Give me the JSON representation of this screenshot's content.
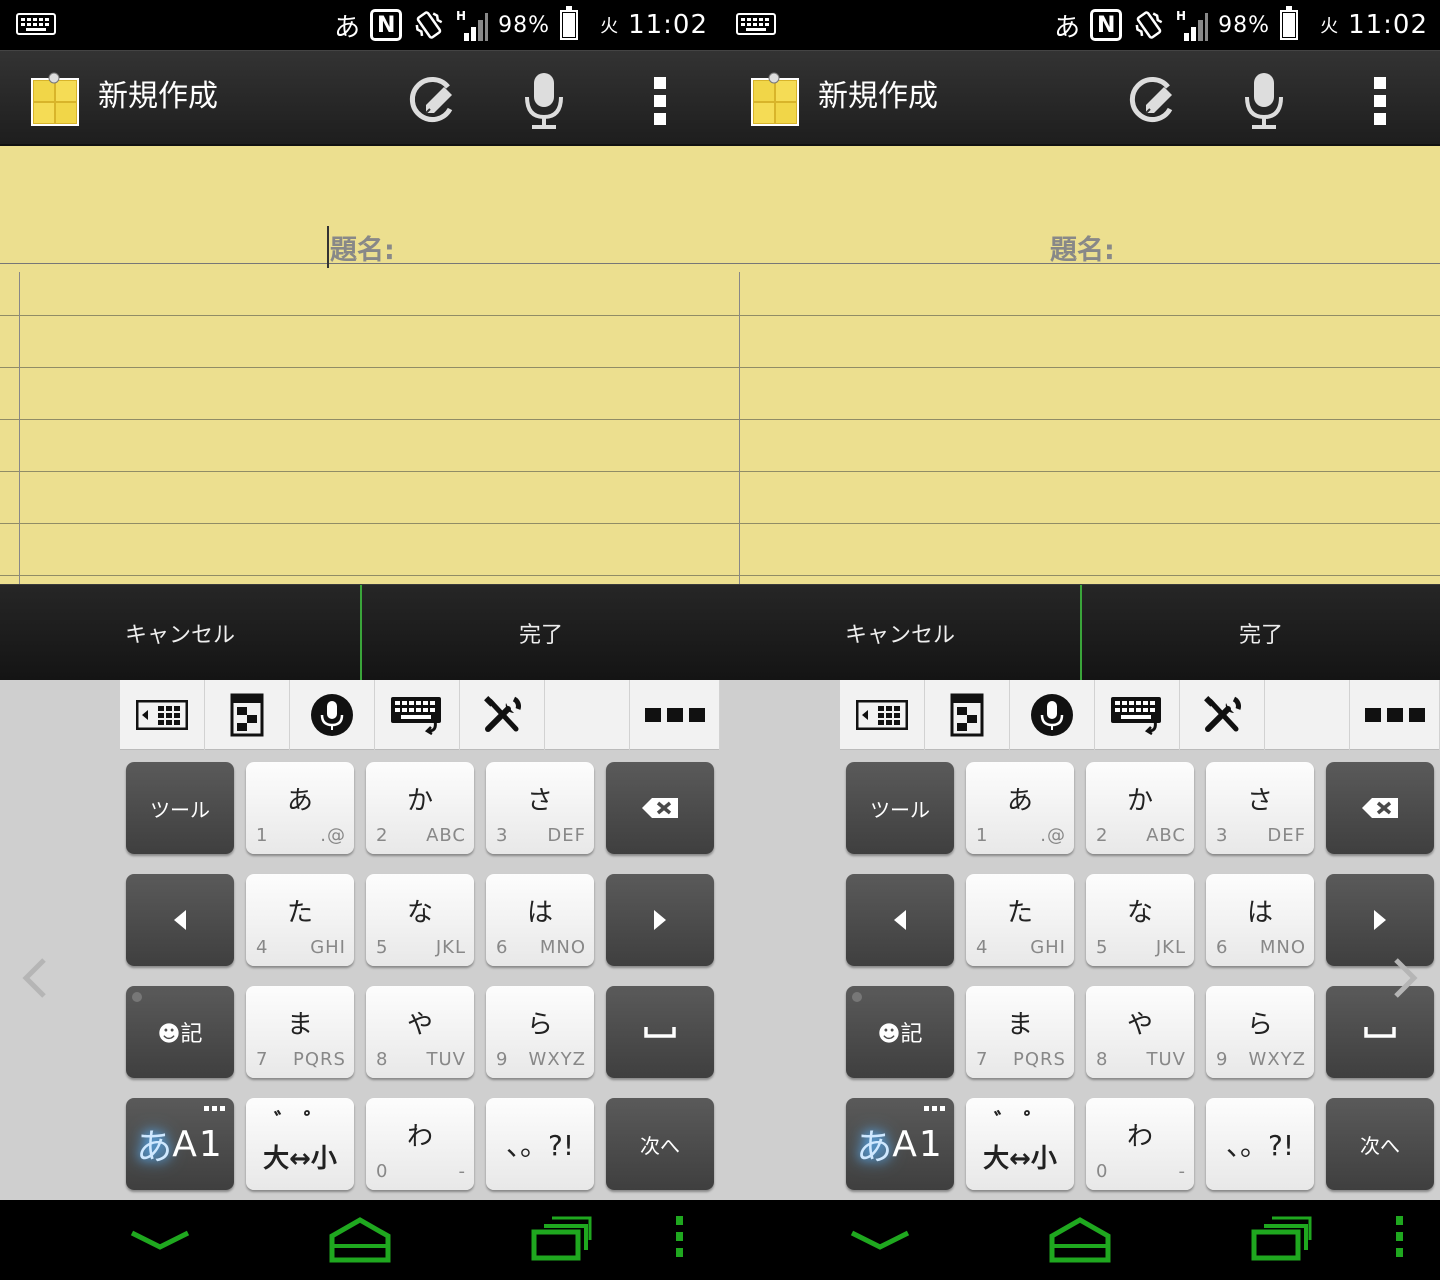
{
  "screens": [
    {
      "status": {
        "ime": "あ",
        "nfc": "N",
        "network": "H",
        "battery_text": "98%",
        "battery_level": 0.98,
        "day": "火",
        "time": "11:02"
      },
      "action_bar": {
        "title": "新規作成"
      },
      "note": {
        "title_label": "題名:"
      },
      "confirm": {
        "cancel": "キャンセル",
        "done": "完了"
      },
      "keyboard": {
        "rows": [
          [
            {
              "main": "ツール",
              "type": "dark"
            },
            {
              "main": "あ",
              "num": "1",
              "sub": ".@"
            },
            {
              "main": "か",
              "num": "2",
              "sub": "ABC"
            },
            {
              "main": "さ",
              "num": "3",
              "sub": "DEF"
            },
            {
              "main": "",
              "type": "dark",
              "icon": "backspace-icon"
            }
          ],
          [
            {
              "main": "",
              "type": "dark",
              "icon": "arrow-left-icon"
            },
            {
              "main": "た",
              "num": "4",
              "sub": "GHI"
            },
            {
              "main": "な",
              "num": "5",
              "sub": "JKL"
            },
            {
              "main": "は",
              "num": "6",
              "sub": "MNO"
            },
            {
              "main": "",
              "type": "dark",
              "icon": "arrow-right-icon"
            }
          ],
          [
            {
              "main": "☻記",
              "type": "dark",
              "dot": true
            },
            {
              "main": "ま",
              "num": "7",
              "sub": "PQRS"
            },
            {
              "main": "や",
              "num": "8",
              "sub": "TUV"
            },
            {
              "main": "ら",
              "num": "9",
              "sub": "WXYZ"
            },
            {
              "main": "␣",
              "type": "dark"
            }
          ],
          [
            {
              "main": "あA1",
              "type": "dark",
              "mode": true
            },
            {
              "main": "大↔小",
              "small_top": "゛ ゜"
            },
            {
              "main": "わ",
              "num": "0",
              "sub": "-"
            },
            {
              "main": "、。?!"
            },
            {
              "main": "次へ",
              "type": "dark"
            }
          ]
        ]
      }
    },
    {
      "status": {
        "ime": "あ",
        "nfc": "N",
        "network": "H",
        "battery_text": "98%",
        "battery_level": 0.98,
        "day": "火",
        "time": "11:02"
      },
      "action_bar": {
        "title": "新規作成"
      },
      "note": {
        "title_label": "題名:"
      },
      "confirm": {
        "cancel": "キャンセル",
        "done": "完了"
      },
      "keyboard": {
        "rows": [
          [
            {
              "main": "ツール",
              "type": "dark"
            },
            {
              "main": "あ",
              "num": "1",
              "sub": ".@"
            },
            {
              "main": "か",
              "num": "2",
              "sub": "ABC"
            },
            {
              "main": "さ",
              "num": "3",
              "sub": "DEF"
            },
            {
              "main": "",
              "type": "dark",
              "icon": "backspace-icon"
            }
          ],
          [
            {
              "main": "",
              "type": "dark",
              "icon": "arrow-left-icon"
            },
            {
              "main": "た",
              "num": "4",
              "sub": "GHI"
            },
            {
              "main": "な",
              "num": "5",
              "sub": "JKL"
            },
            {
              "main": "は",
              "num": "6",
              "sub": "MNO"
            },
            {
              "main": "",
              "type": "dark",
              "icon": "arrow-right-icon"
            }
          ],
          [
            {
              "main": "☻記",
              "type": "dark",
              "dot": true
            },
            {
              "main": "ま",
              "num": "7",
              "sub": "PQRS"
            },
            {
              "main": "や",
              "num": "8",
              "sub": "TUV"
            },
            {
              "main": "ら",
              "num": "9",
              "sub": "WXYZ"
            },
            {
              "main": "␣",
              "type": "dark"
            }
          ],
          [
            {
              "main": "あA1",
              "type": "dark",
              "mode": true
            },
            {
              "main": "大↔小",
              "small_top": "゛ ゜"
            },
            {
              "main": "わ",
              "num": "0",
              "sub": "-"
            },
            {
              "main": "、。?!"
            },
            {
              "main": "次へ",
              "type": "dark"
            }
          ]
        ]
      }
    }
  ],
  "colors": {
    "accent_green": "#3aa53a",
    "nav_green": "#1fa81f",
    "pad_yellow": "#ecdf8f",
    "mode_glow": "#5ab4ff"
  }
}
